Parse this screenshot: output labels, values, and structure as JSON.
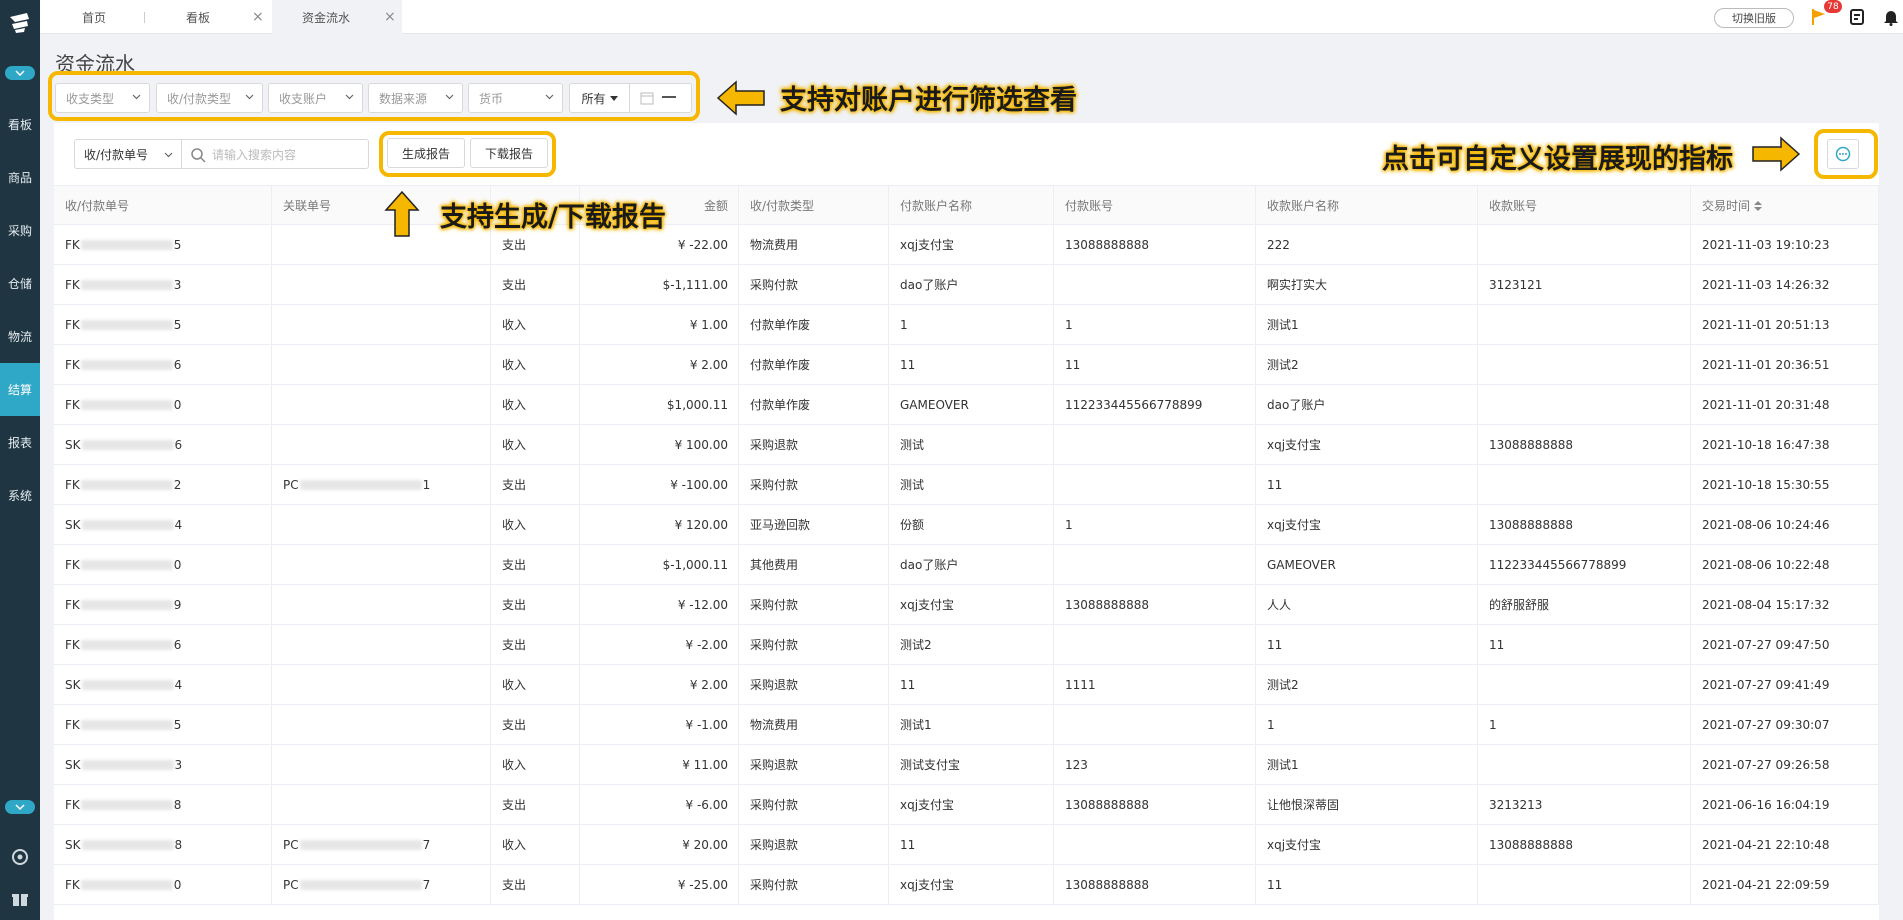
{
  "tabs": [
    {
      "label": "首页"
    },
    {
      "label": "看板"
    },
    {
      "label": "资金流水"
    }
  ],
  "header": {
    "old_version": "切换旧版",
    "badge_count": "78"
  },
  "sidebar": {
    "items": [
      {
        "label": "看板"
      },
      {
        "label": "商品"
      },
      {
        "label": "采购"
      },
      {
        "label": "仓储"
      },
      {
        "label": "物流"
      },
      {
        "label": "结算"
      },
      {
        "label": "报表"
      },
      {
        "label": "系统"
      }
    ]
  },
  "page_title": "资金流水",
  "filters": {
    "f1": "收支类型",
    "f2": "收/付款类型",
    "f3": "收支账户",
    "f4": "数据来源",
    "f5": "货币",
    "all": "所有"
  },
  "search": {
    "type": "收/付款单号",
    "placeholder": "请输入搜索内容"
  },
  "buttons": {
    "generate": "生成报告",
    "download": "下载报告"
  },
  "annotations": {
    "filter": "支持对账户进行筛选查看",
    "report": "支持生成/下载报告",
    "custom": "点击可自定义设置展现的指标"
  },
  "table": {
    "columns": [
      "收/付款单号",
      "关联单号",
      "",
      "金额",
      "收/付款类型",
      "付款账户名称",
      "付款账号",
      "收款账户名称",
      "收款账号",
      "交易时间"
    ],
    "rows": [
      {
        "id_pre": "FK",
        "id_suf": "5",
        "rel_pre": "",
        "rel_suf": "",
        "dir": "支出",
        "amt": "¥ -22.00",
        "type": "物流费用",
        "pay_name": "xqj支付宝",
        "pay_acc": "13088888888",
        "rec_name": "222",
        "rec_acc": "",
        "time": "2021-11-03 19:10:23"
      },
      {
        "id_pre": "FK",
        "id_suf": "3",
        "rel_pre": "",
        "rel_suf": "",
        "dir": "支出",
        "amt": "$-1,111.00",
        "type": "采购付款",
        "pay_name": "dao了账户",
        "pay_acc": "",
        "rec_name": "啊实打实大",
        "rec_acc": "3123121",
        "time": "2021-11-03 14:26:32"
      },
      {
        "id_pre": "FK",
        "id_suf": "5",
        "rel_pre": "",
        "rel_suf": "",
        "dir": "收入",
        "amt": "¥ 1.00",
        "type": "付款单作废",
        "pay_name": "1",
        "pay_acc": "1",
        "rec_name": "测试1",
        "rec_acc": "",
        "time": "2021-11-01 20:51:13"
      },
      {
        "id_pre": "FK",
        "id_suf": "6",
        "rel_pre": "",
        "rel_suf": "",
        "dir": "收入",
        "amt": "¥ 2.00",
        "type": "付款单作废",
        "pay_name": "11",
        "pay_acc": "11",
        "rec_name": "测试2",
        "rec_acc": "",
        "time": "2021-11-01 20:36:51"
      },
      {
        "id_pre": "FK",
        "id_suf": "0",
        "rel_pre": "",
        "rel_suf": "",
        "dir": "收入",
        "amt": "$1,000.11",
        "type": "付款单作废",
        "pay_name": "GAMEOVER",
        "pay_acc": "112233445566778899",
        "rec_name": "dao了账户",
        "rec_acc": "",
        "time": "2021-11-01 20:31:48"
      },
      {
        "id_pre": "SK",
        "id_suf": "6",
        "rel_pre": "",
        "rel_suf": "",
        "dir": "收入",
        "amt": "¥ 100.00",
        "type": "采购退款",
        "pay_name": "测试",
        "pay_acc": "",
        "rec_name": "xqj支付宝",
        "rec_acc": "13088888888",
        "time": "2021-10-18 16:47:38"
      },
      {
        "id_pre": "FK",
        "id_suf": "2",
        "rel_pre": "PC",
        "rel_suf": "1",
        "dir": "支出",
        "amt": "¥ -100.00",
        "type": "采购付款",
        "pay_name": "测试",
        "pay_acc": "",
        "rec_name": "11",
        "rec_acc": "",
        "time": "2021-10-18 15:30:55"
      },
      {
        "id_pre": "SK",
        "id_suf": "4",
        "rel_pre": "",
        "rel_suf": "",
        "dir": "收入",
        "amt": "¥ 120.00",
        "type": "亚马逊回款",
        "pay_name": "份额",
        "pay_acc": "1",
        "rec_name": "xqj支付宝",
        "rec_acc": "13088888888",
        "time": "2021-08-06 10:24:46"
      },
      {
        "id_pre": "FK",
        "id_suf": "0",
        "rel_pre": "",
        "rel_suf": "",
        "dir": "支出",
        "amt": "$-1,000.11",
        "type": "其他费用",
        "pay_name": "dao了账户",
        "pay_acc": "",
        "rec_name": "GAMEOVER",
        "rec_acc": "112233445566778899",
        "time": "2021-08-06 10:22:48"
      },
      {
        "id_pre": "FK",
        "id_suf": "9",
        "rel_pre": "",
        "rel_suf": "",
        "dir": "支出",
        "amt": "¥ -12.00",
        "type": "采购付款",
        "pay_name": "xqj支付宝",
        "pay_acc": "13088888888",
        "rec_name": "人人",
        "rec_acc": "的舒服舒服",
        "time": "2021-08-04 15:17:32"
      },
      {
        "id_pre": "FK",
        "id_suf": "6",
        "rel_pre": "",
        "rel_suf": "",
        "dir": "支出",
        "amt": "¥ -2.00",
        "type": "采购付款",
        "pay_name": "测试2",
        "pay_acc": "",
        "rec_name": "11",
        "rec_acc": "11",
        "time": "2021-07-27 09:47:50"
      },
      {
        "id_pre": "SK",
        "id_suf": "4",
        "rel_pre": "",
        "rel_suf": "",
        "dir": "收入",
        "amt": "¥ 2.00",
        "type": "采购退款",
        "pay_name": "11",
        "pay_acc": "1111",
        "rec_name": "测试2",
        "rec_acc": "",
        "time": "2021-07-27 09:41:49"
      },
      {
        "id_pre": "FK",
        "id_suf": "5",
        "rel_pre": "",
        "rel_suf": "",
        "dir": "支出",
        "amt": "¥ -1.00",
        "type": "物流费用",
        "pay_name": "测试1",
        "pay_acc": "",
        "rec_name": "1",
        "rec_acc": "1",
        "time": "2021-07-27 09:30:07"
      },
      {
        "id_pre": "SK",
        "id_suf": "3",
        "rel_pre": "",
        "rel_suf": "",
        "dir": "收入",
        "amt": "¥ 11.00",
        "type": "采购退款",
        "pay_name": "测试支付宝",
        "pay_acc": "123",
        "rec_name": "测试1",
        "rec_acc": "",
        "time": "2021-07-27 09:26:58"
      },
      {
        "id_pre": "FK",
        "id_suf": "8",
        "rel_pre": "",
        "rel_suf": "",
        "dir": "支出",
        "amt": "¥ -6.00",
        "type": "采购付款",
        "pay_name": "xqj支付宝",
        "pay_acc": "13088888888",
        "rec_name": "让他恨深蒂固",
        "rec_acc": "3213213",
        "time": "2021-06-16 16:04:19"
      },
      {
        "id_pre": "SK",
        "id_suf": "8",
        "rel_pre": "PC",
        "rel_suf": "7",
        "dir": "收入",
        "amt": "¥ 20.00",
        "type": "采购退款",
        "pay_name": "11",
        "pay_acc": "",
        "rec_name": "xqj支付宝",
        "rec_acc": "13088888888",
        "time": "2021-04-21 22:10:48"
      },
      {
        "id_pre": "FK",
        "id_suf": "0",
        "rel_pre": "PC",
        "rel_suf": "7",
        "dir": "支出",
        "amt": "¥ -25.00",
        "type": "采购付款",
        "pay_name": "xqj支付宝",
        "pay_acc": "13088888888",
        "rec_name": "11",
        "rec_acc": "",
        "time": "2021-04-21 22:09:59"
      }
    ]
  }
}
